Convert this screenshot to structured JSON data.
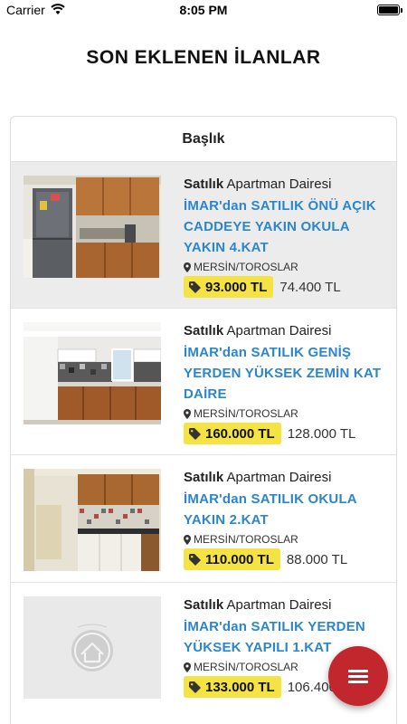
{
  "status_bar": {
    "carrier": "Carrier",
    "time": "8:05 PM"
  },
  "page": {
    "title": "SON EKLENEN İLANLAR"
  },
  "list": {
    "column_header": "Başlık",
    "listings": [
      {
        "sale_type": "Satılık",
        "property_type": "Apartman Dairesi",
        "title": "İMAR'dan SATILIK ÖNÜ AÇIK CADDEYE YAKIN OKULA YAKIN 4.KAT",
        "location": "MERSİN/TOROSLAR",
        "price": "93.000 TL",
        "alt_price": "74.400 TL",
        "image": "kitchen-photo-1"
      },
      {
        "sale_type": "Satılık",
        "property_type": "Apartman Dairesi",
        "title": "İMAR'dan SATILIK GENİŞ YERDEN YÜKSEK ZEMİN KAT DAİRE",
        "location": "MERSİN/TOROSLAR",
        "price": "160.000 TL",
        "alt_price": "128.000 TL",
        "image": "kitchen-photo-2"
      },
      {
        "sale_type": "Satılık",
        "property_type": "Apartman Dairesi",
        "title": "İMAR'dan SATILIK OKULA YAKIN 2.KAT",
        "location": "MERSİN/TOROSLAR",
        "price": "110.000 TL",
        "alt_price": "88.000 TL",
        "image": "kitchen-photo-3"
      },
      {
        "sale_type": "Satılık",
        "property_type": "Apartman Dairesi",
        "title": "İMAR'dan SATILIK YERDEN YÜKSEK YAPILI 1.KAT",
        "location": "MERSİN/TOROSLAR",
        "price": "133.000 TL",
        "alt_price": "106.400 TL",
        "image": "placeholder-logo"
      }
    ]
  },
  "fab": {
    "icon": "menu-icon",
    "color": "#c1272d"
  },
  "colors": {
    "link": "#2c86c9",
    "price_badge": "#f5e343",
    "highlight_row": "#ececec"
  }
}
